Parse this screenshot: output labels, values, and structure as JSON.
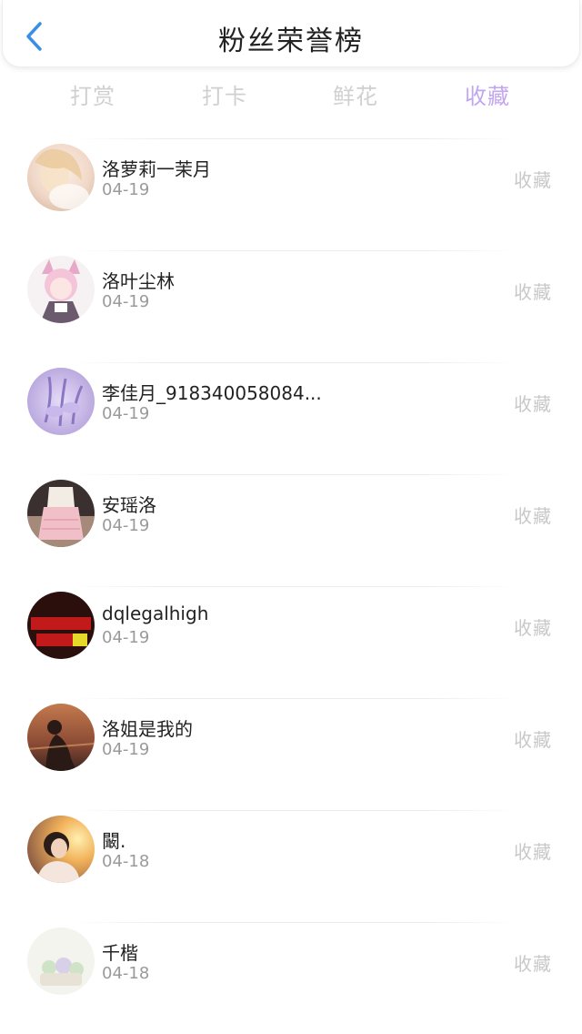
{
  "header": {
    "title": "粉丝荣誉榜",
    "back_icon": "chevron-left-icon",
    "accent": "#3a8ee6"
  },
  "tabs": [
    {
      "label": "打赏",
      "active": false
    },
    {
      "label": "打卡",
      "active": false
    },
    {
      "label": "鲜花",
      "active": false
    },
    {
      "label": "收藏",
      "active": true
    }
  ],
  "colors": {
    "active_tab": "#c3a6f0",
    "inactive_tab": "#d0d0d0",
    "action_text": "#c8c8c8"
  },
  "fans": [
    {
      "name": "洛萝莉一茉月",
      "date": "04-19",
      "action": "收藏"
    },
    {
      "name": "洛叶尘林",
      "date": "04-19",
      "action": "收藏"
    },
    {
      "name": "李佳月_918340058084...",
      "date": "04-19",
      "action": "收藏"
    },
    {
      "name": "安瑶洛",
      "date": "04-19",
      "action": "收藏"
    },
    {
      "name": "dqlegalhigh",
      "date": "04-19",
      "action": "收藏"
    },
    {
      "name": "洛姐是我的",
      "date": "04-19",
      "action": "收藏"
    },
    {
      "name": "闞.",
      "date": "04-18",
      "action": "收藏"
    },
    {
      "name": "千楷",
      "date": "04-18",
      "action": "收藏"
    }
  ]
}
